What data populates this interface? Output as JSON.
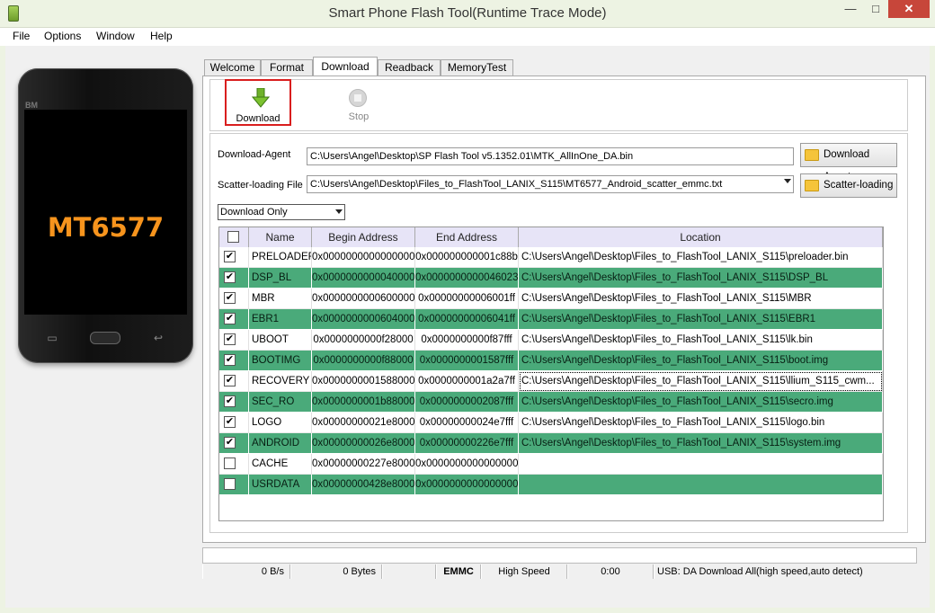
{
  "window": {
    "title": "Smart Phone Flash Tool(Runtime Trace Mode)",
    "min": "—",
    "max": "□",
    "close": "✕"
  },
  "menu": [
    "File",
    "Options",
    "Window",
    "Help"
  ],
  "phone": {
    "brand": "BM",
    "chip": "MT6577",
    "menu_glyph": "▭",
    "back_glyph": "↩"
  },
  "tabs": [
    "Welcome",
    "Format",
    "Download",
    "Readback",
    "MemoryTest"
  ],
  "toolbar": {
    "download": "Download",
    "stop": "Stop"
  },
  "form": {
    "da_label": "Download-Agent",
    "da_value": "C:\\Users\\Angel\\Desktop\\SP Flash Tool v5.1352.01\\MTK_AllInOne_DA.bin",
    "da_button": "Download Agent",
    "scatter_label": "Scatter-loading File",
    "scatter_value": "C:\\Users\\Angel\\Desktop\\Files_to_FlashTool_LANIX_S115\\MT6577_Android_scatter_emmc.txt",
    "scatter_button": "Scatter-loading",
    "mode": "Download Only"
  },
  "table": {
    "headers": [
      "Name",
      "Begin Address",
      "End Address",
      "Location"
    ],
    "rows": [
      {
        "checked": true,
        "name": "PRELOADER",
        "begin": "0x0000000000000000",
        "end": "0x000000000001c88b",
        "loc": "C:\\Users\\Angel\\Desktop\\Files_to_FlashTool_LANIX_S115\\preloader.bin"
      },
      {
        "checked": true,
        "name": "DSP_BL",
        "begin": "0x0000000000040000",
        "end": "0x0000000000046023",
        "loc": "C:\\Users\\Angel\\Desktop\\Files_to_FlashTool_LANIX_S115\\DSP_BL"
      },
      {
        "checked": true,
        "name": "MBR",
        "begin": "0x0000000000600000",
        "end": "0x00000000006001ff",
        "loc": "C:\\Users\\Angel\\Desktop\\Files_to_FlashTool_LANIX_S115\\MBR"
      },
      {
        "checked": true,
        "name": "EBR1",
        "begin": "0x0000000000604000",
        "end": "0x00000000006041ff",
        "loc": "C:\\Users\\Angel\\Desktop\\Files_to_FlashTool_LANIX_S115\\EBR1"
      },
      {
        "checked": true,
        "name": "UBOOT",
        "begin": "0x0000000000f28000",
        "end": "0x0000000000f87fff",
        "loc": "C:\\Users\\Angel\\Desktop\\Files_to_FlashTool_LANIX_S115\\lk.bin"
      },
      {
        "checked": true,
        "name": "BOOTIMG",
        "begin": "0x0000000000f88000",
        "end": "0x0000000001587fff",
        "loc": "C:\\Users\\Angel\\Desktop\\Files_to_FlashTool_LANIX_S115\\boot.img"
      },
      {
        "checked": true,
        "name": "RECOVERY",
        "begin": "0x0000000001588000",
        "end": "0x0000000001a2a7ff",
        "loc": "C:\\Users\\Angel\\Desktop\\Files_to_FlashTool_LANIX_S115\\llium_S115_cwm..."
      },
      {
        "checked": true,
        "name": "SEC_RO",
        "begin": "0x0000000001b88000",
        "end": "0x0000000002087fff",
        "loc": "C:\\Users\\Angel\\Desktop\\Files_to_FlashTool_LANIX_S115\\secro.img"
      },
      {
        "checked": true,
        "name": "LOGO",
        "begin": "0x00000000021e8000",
        "end": "0x00000000024e7fff",
        "loc": "C:\\Users\\Angel\\Desktop\\Files_to_FlashTool_LANIX_S115\\logo.bin"
      },
      {
        "checked": true,
        "name": "ANDROID",
        "begin": "0x00000000026e8000",
        "end": "0x00000000226e7fff",
        "loc": "C:\\Users\\Angel\\Desktop\\Files_to_FlashTool_LANIX_S115\\system.img"
      },
      {
        "checked": false,
        "name": "CACHE",
        "begin": "0x00000000227e8000",
        "end": "0x0000000000000000",
        "loc": ""
      },
      {
        "checked": false,
        "name": "USRDATA",
        "begin": "0x00000000428e8000",
        "end": "0x0000000000000000",
        "loc": ""
      }
    ]
  },
  "status": {
    "speed": "0 B/s",
    "bytes": "0 Bytes",
    "storage": "EMMC",
    "usb_speed": "High Speed",
    "time": "0:00",
    "usb_msg": "USB: DA Download All(high speed,auto detect)"
  },
  "colors": {
    "row_green": "#4aaa7a",
    "header": "#e7e4f7",
    "chip": "#f7941d",
    "highlight": "#d91e1e"
  }
}
